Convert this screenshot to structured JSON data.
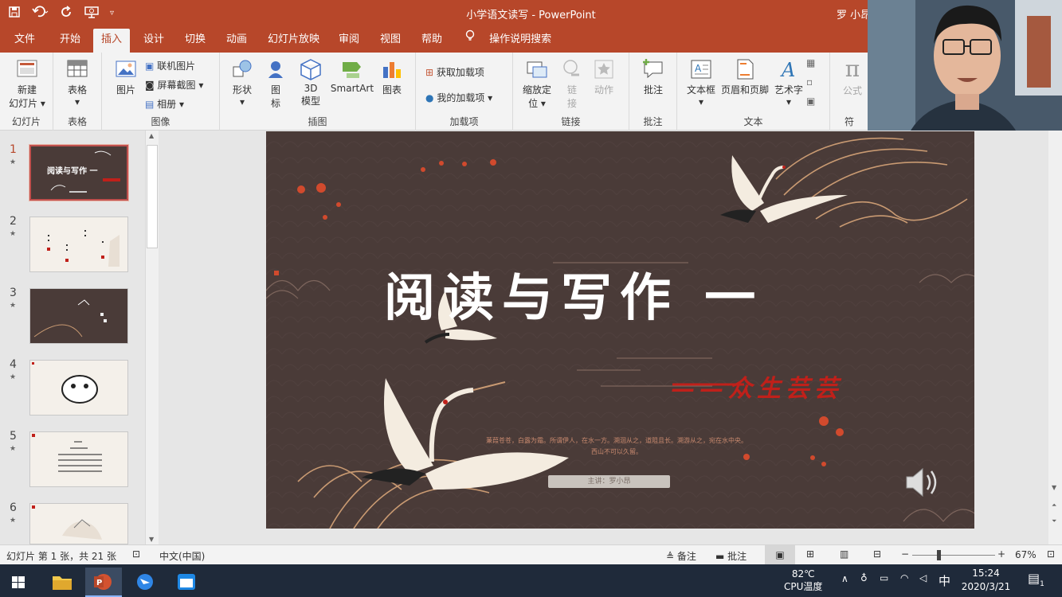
{
  "titlebar": {
    "doc_title": "小学语文读写  -  PowerPoint",
    "user": "罗 小昂",
    "qat_icons": [
      "save-icon",
      "undo-icon",
      "redo-icon",
      "presenter-icon",
      "customize-icon"
    ]
  },
  "tabs": [
    "文件",
    "开始",
    "插入",
    "设计",
    "切换",
    "动画",
    "幻灯片放映",
    "审阅",
    "视图",
    "帮助"
  ],
  "active_tab": "插入",
  "tell_me": "操作说明搜索",
  "ribbon": {
    "slides": {
      "new_slide_line1": "新建",
      "new_slide_line2": "幻灯片",
      "label": "幻灯片"
    },
    "tables": {
      "table": "表格",
      "label": "表格"
    },
    "images": {
      "picture": "图片",
      "online": "联机图片",
      "screenshot": "屏幕截图",
      "album": "相册",
      "label": "图像"
    },
    "illustrations": {
      "shapes": "形状",
      "icons_1": "图",
      "icons_2": "标",
      "model_1": "3D",
      "model_2": "模型",
      "smartart": "SmartArt",
      "chart": "图表",
      "label": "插图"
    },
    "addins": {
      "get": "获取加载项",
      "mine": "我的加载项",
      "label": "加载项"
    },
    "links": {
      "zoom_1": "缩放定",
      "zoom_2": "位",
      "link_1": "链",
      "link_2": "接",
      "action": "动作",
      "label": "链接"
    },
    "comments": {
      "comment": "批注",
      "label": "批注"
    },
    "text": {
      "textbox": "文本框",
      "header_footer": "页眉和页脚",
      "wordart": "艺术字",
      "label": "文本"
    },
    "symbols": {
      "equation": "公式",
      "label": "符"
    }
  },
  "thumbnails": [
    {
      "num": "1",
      "title": "阅读与写作 一"
    },
    {
      "num": "2"
    },
    {
      "num": "3"
    },
    {
      "num": "4"
    },
    {
      "num": "5"
    },
    {
      "num": "6"
    }
  ],
  "slide": {
    "title": "阅读与写作  一",
    "subtitle": "——众生芸芸",
    "body_line1": "蒹葭苍苍，白露为霜。所谓伊人，在水一方。溯洄从之，道阻且长。溯游从之，宛在水中央。",
    "body_line2": "西山不可以久留。",
    "presenter": "主讲：罗小昂",
    "colors": {
      "background": "#4a3b38",
      "accent": "#c0201a",
      "gold": "#c99a72"
    }
  },
  "status": {
    "slide_info": "幻灯片 第 1 张，共 21 张",
    "language": "中文(中国)",
    "notes": "备注",
    "comments": "批注",
    "zoom": "67%",
    "zoom_level": 0.67
  },
  "taskbar": {
    "temp": "82℃",
    "temp_label": "CPU温度",
    "ime": "中",
    "time": "15:24",
    "date": "2020/3/21",
    "notify_count": "1"
  }
}
